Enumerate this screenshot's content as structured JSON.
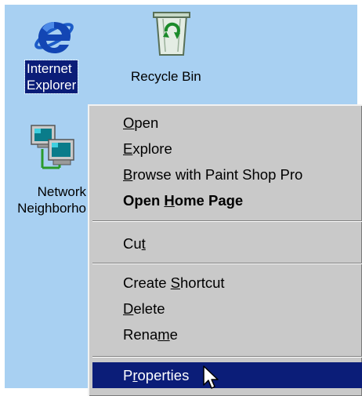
{
  "desktop": {
    "background": "#a8d0f2",
    "icons": [
      {
        "icon": "internet-explorer-icon",
        "label_lines": [
          "Internet",
          "Explorer"
        ],
        "selected": true
      },
      {
        "icon": "recycle-bin-icon",
        "label": "Recycle Bin",
        "selected": false
      },
      {
        "icon": "network-neighborhood-icon",
        "label_lines": [
          "Network",
          "Neighborho"
        ],
        "selected": false
      }
    ]
  },
  "context_menu": {
    "items": [
      {
        "label": "Open",
        "mnemonic": "O"
      },
      {
        "label": "Explore",
        "mnemonic": "E"
      },
      {
        "label": "Browse with Paint Shop Pro",
        "mnemonic": "B"
      },
      {
        "label": "Open Home Page",
        "mnemonic": "H",
        "bold": true
      },
      {
        "label": "Cut",
        "mnemonic": "t"
      },
      {
        "label": "Create Shortcut",
        "mnemonic": "S"
      },
      {
        "label": "Delete",
        "mnemonic": "D"
      },
      {
        "label": "Rename",
        "mnemonic": "m"
      },
      {
        "label": "Properties",
        "mnemonic": "r",
        "highlighted": true
      }
    ],
    "highlight_color": "#0b1d78"
  }
}
